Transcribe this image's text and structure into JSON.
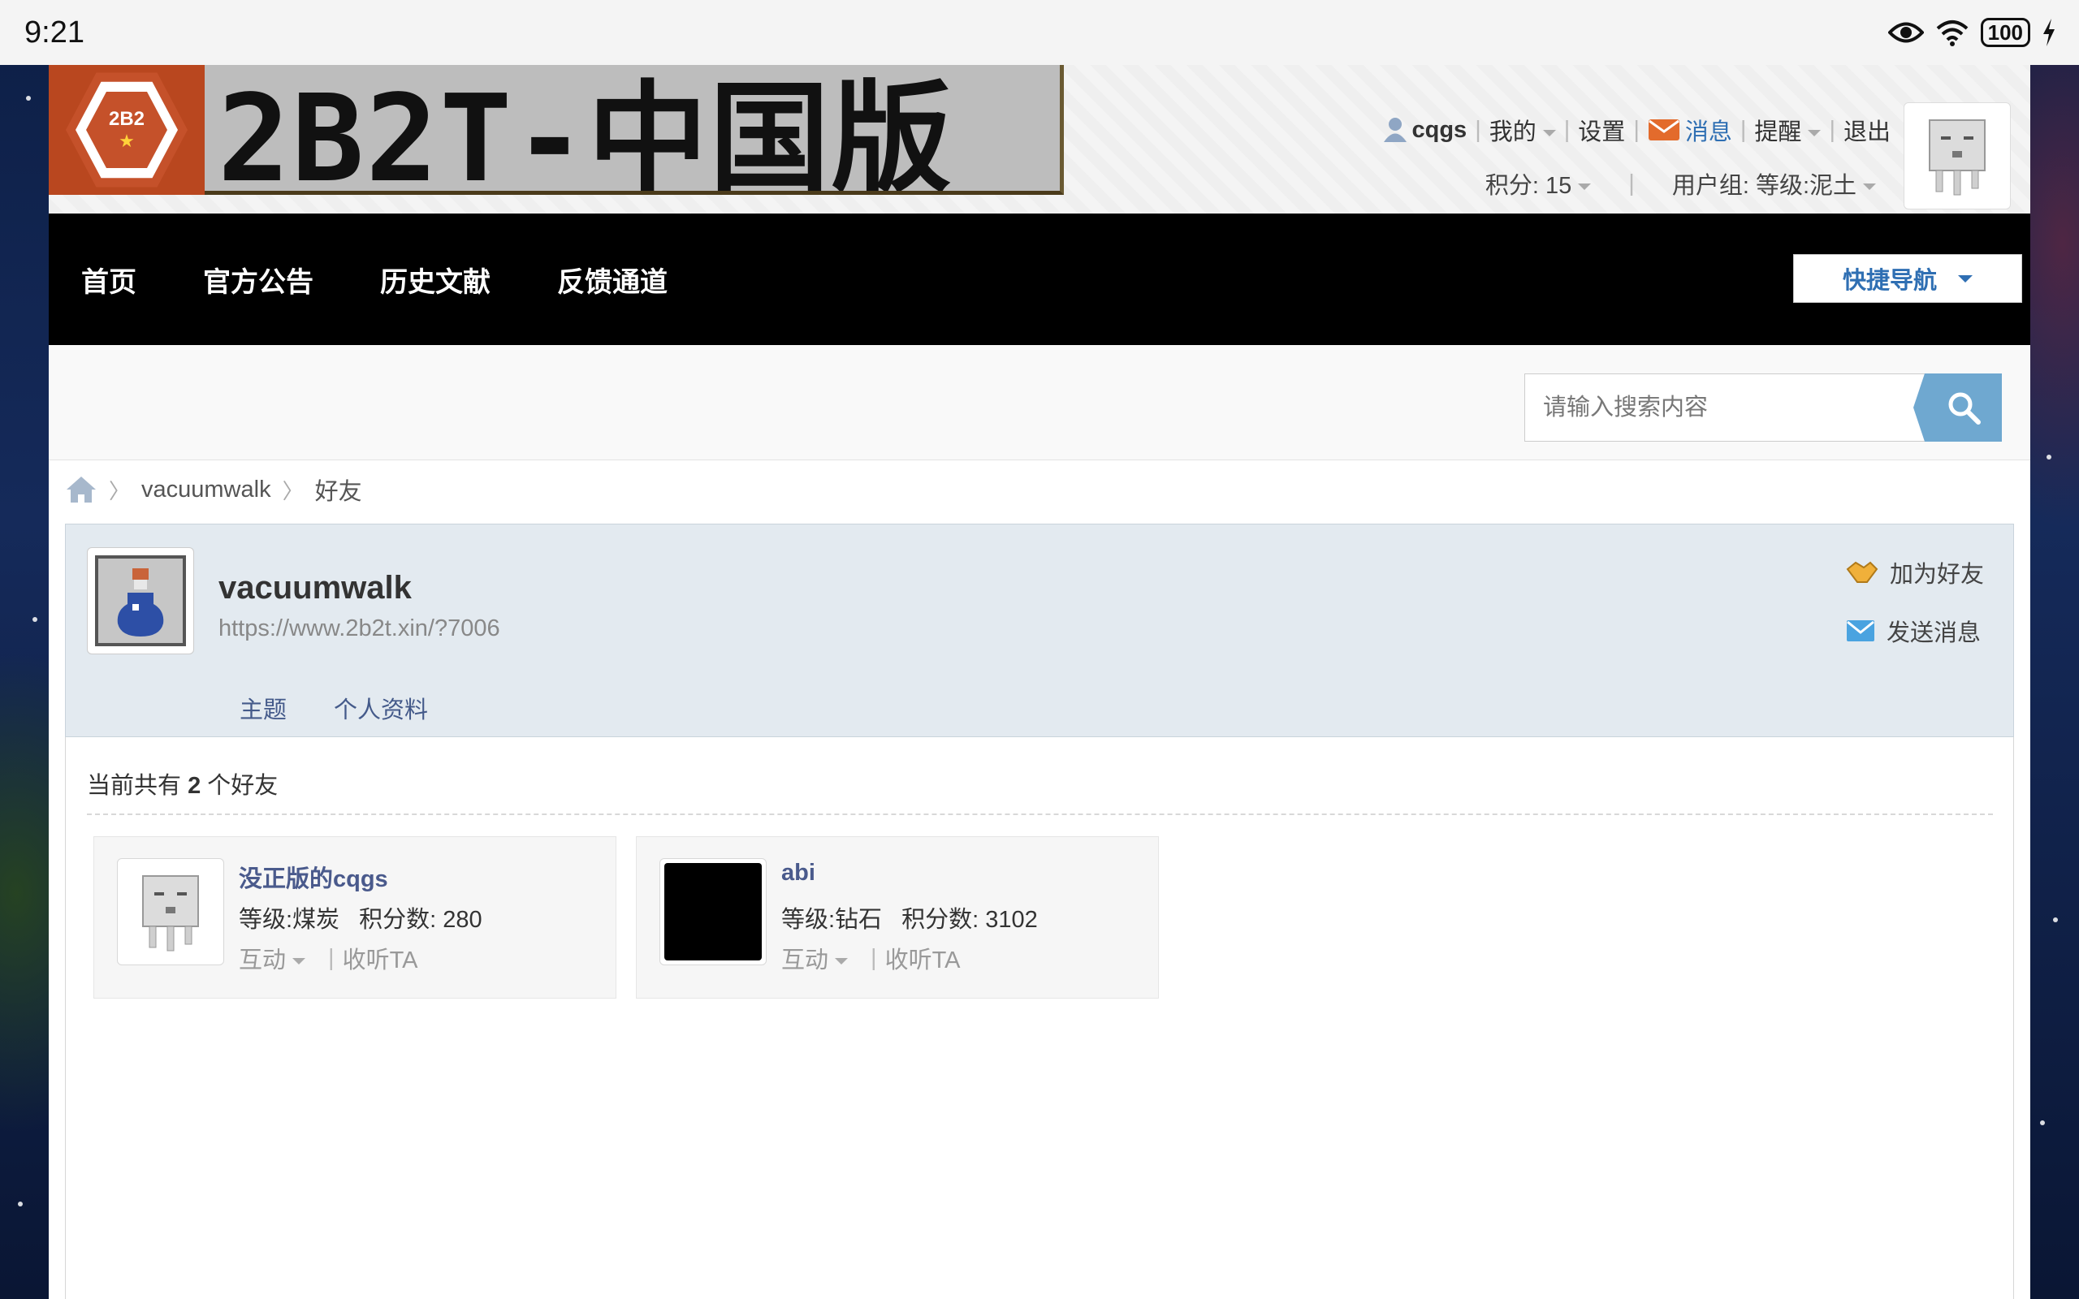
{
  "status_bar": {
    "time": "9:21",
    "battery": "100"
  },
  "header": {
    "logo_badge_text": "2B2",
    "banner_text": "2B2T-中国版",
    "user": {
      "username": "cqgs",
      "mine": "我的",
      "settings": "设置",
      "messages": "消息",
      "reminders": "提醒",
      "logout": "退出"
    },
    "credits": "积分: 15",
    "user_group": "用户组: 等级:泥土"
  },
  "nav": {
    "items": [
      "首页",
      "官方公告",
      "历史文献",
      "反馈通道"
    ],
    "quick_nav": "快捷导航"
  },
  "search": {
    "placeholder": "请输入搜索内容"
  },
  "breadcrumb": {
    "user": "vacuumwalk",
    "page": "好友"
  },
  "profile": {
    "name": "vacuumwalk",
    "url": "https://www.2b2t.xin/?7006",
    "tabs": [
      "主题",
      "个人资料"
    ],
    "actions": {
      "add_friend": "加为好友",
      "send_message": "发送消息"
    }
  },
  "friends": {
    "count_prefix": "当前共有",
    "count": "2",
    "count_suffix": "个好友",
    "list": [
      {
        "name": "没正版的cqgs",
        "level": "等级:煤炭",
        "points": "积分数: 280",
        "interact": "互动",
        "follow": "收听TA"
      },
      {
        "name": "abi",
        "level": "等级:钻石",
        "points": "积分数: 3102",
        "interact": "互动",
        "follow": "收听TA"
      }
    ]
  },
  "colors": {
    "accent": "#2f6fb3",
    "nav_bg": "#000000",
    "profile_bg": "#e3eaf0",
    "search_button": "#6fa8d0"
  }
}
